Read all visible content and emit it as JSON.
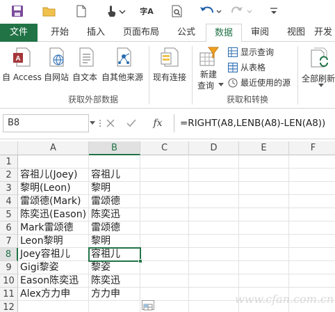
{
  "quick_access": {
    "items": [
      {
        "name": "save-icon"
      },
      {
        "name": "open-icon"
      },
      {
        "name": "new-icon"
      },
      {
        "name": "touch-mode-icon"
      },
      {
        "name": "spelling-icon",
        "glyph": "字A"
      },
      {
        "name": "print-preview-icon"
      },
      {
        "name": "undo-icon"
      },
      {
        "name": "redo-icon"
      },
      {
        "name": "customize-qat-icon"
      }
    ]
  },
  "tabs": [
    "文件",
    "开始",
    "插入",
    "页面布局",
    "公式",
    "数据",
    "审阅",
    "视图",
    "开发"
  ],
  "active_tab": "数据",
  "ribbon": {
    "get_external": {
      "buttons": [
        "自 Access",
        "自网站",
        "自文本",
        "自其他来源",
        "现有连接"
      ],
      "group_label": "获取外部数据"
    },
    "transform": {
      "new_query": [
        "新建",
        "查询"
      ],
      "small_commands": [
        "显示查询",
        "从表格",
        "最近使用的源"
      ],
      "group_label": "获取和转换"
    },
    "refresh_all": "全部刷新"
  },
  "formula_bar": {
    "name_box": "B8",
    "fx": "fx",
    "formula": "=RIGHT(A8,LENB(A8)-LEN(A8))"
  },
  "grid": {
    "columns": [
      "A",
      "B",
      "C",
      "D",
      "E",
      "F"
    ],
    "selected_column": "B",
    "rows": [
      {
        "num": "1",
        "a": "",
        "b": ""
      },
      {
        "num": "2",
        "a": "容祖儿(Joey)",
        "b": "容祖儿"
      },
      {
        "num": "3",
        "a": "黎明(Leon)",
        "b": "黎明"
      },
      {
        "num": "4",
        "a": "雷颂德(Mark)",
        "b": "雷颂德"
      },
      {
        "num": "5",
        "a": "陈奕迅(Eason)",
        "b": "陈奕迅"
      },
      {
        "num": "6",
        "a": "Mark雷颂德",
        "b": "雷颂德"
      },
      {
        "num": "7",
        "a": "Leon黎明",
        "b": "黎明"
      },
      {
        "num": "8",
        "a": "Joey容祖儿",
        "b": "容祖儿"
      },
      {
        "num": "9",
        "a": "Gigi黎姿",
        "b": "黎姿"
      },
      {
        "num": "10",
        "a": "Eason陈奕迅",
        "b": "陈奕迅"
      },
      {
        "num": "11",
        "a": "Alex方力申",
        "b": "方力申"
      },
      {
        "num": "12",
        "a": "",
        "b": ""
      }
    ],
    "selected_row": "8",
    "active_cell": "B8"
  },
  "watermark": "www.cfan.com.cn",
  "colors": {
    "accent": "#217346",
    "header_bg": "#f3f3f3"
  }
}
